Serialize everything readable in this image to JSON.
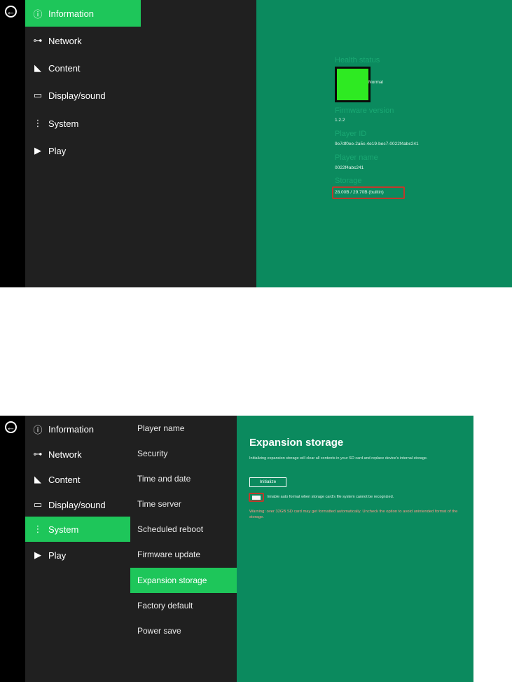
{
  "screen1": {
    "menu": [
      {
        "icon": "info-icon",
        "glyph": "ⓘ",
        "label": "Information",
        "active": true
      },
      {
        "icon": "network-icon",
        "glyph": "⊶",
        "label": "Network",
        "active": false
      },
      {
        "icon": "content-icon",
        "glyph": "◣",
        "label": "Content",
        "active": false
      },
      {
        "icon": "display-icon",
        "glyph": "▭",
        "label": "Display/sound",
        "active": false
      },
      {
        "icon": "system-icon",
        "glyph": "⋮",
        "label": "System",
        "active": false
      },
      {
        "icon": "play-icon",
        "glyph": "▶",
        "label": "Play",
        "active": false
      }
    ],
    "info": {
      "health_heading": "Health status",
      "health_value": "Normal",
      "firmware_heading": "Firmware version",
      "firmware_value": "1.2.2",
      "player_id_heading": "Player ID",
      "player_id_value": "9e7df0ee-2a5c-4e19-bec7-0022f4abc241",
      "player_name_heading": "Player name",
      "player_name_value": "0022f4abc241",
      "storage_heading": "Storage",
      "storage_value": "28.00B / 29.70B (builtin)"
    }
  },
  "screen2": {
    "menu": [
      {
        "icon": "info-icon",
        "glyph": "ⓘ",
        "label": "Information",
        "active": false
      },
      {
        "icon": "network-icon",
        "glyph": "⊶",
        "label": "Network",
        "active": false
      },
      {
        "icon": "content-icon",
        "glyph": "◣",
        "label": "Content",
        "active": false
      },
      {
        "icon": "display-icon",
        "glyph": "▭",
        "label": "Display/sound",
        "active": false
      },
      {
        "icon": "system-icon",
        "glyph": "⋮",
        "label": "System",
        "active": true
      },
      {
        "icon": "play-icon",
        "glyph": "▶",
        "label": "Play",
        "active": false
      }
    ],
    "submenu": [
      {
        "label": "Player name",
        "active": false
      },
      {
        "label": "Security",
        "active": false
      },
      {
        "label": "Time and date",
        "active": false
      },
      {
        "label": "Time server",
        "active": false
      },
      {
        "label": "Scheduled reboot",
        "active": false
      },
      {
        "label": "Firmware update",
        "active": false
      },
      {
        "label": "Expansion storage",
        "active": true
      },
      {
        "label": "Factory default",
        "active": false
      },
      {
        "label": "Power save",
        "active": false
      }
    ],
    "expansion": {
      "title": "Expansion storage",
      "description": "Initializing expansion storage will clear all contents in your SD card and replace device's internal storage.",
      "initialize_label": "Initialize",
      "toggle_label": "Enable auto format when storage card's file system cannot be recognized.",
      "toggle_on": true,
      "warning": "Warning: over 32GB SD card may get formatted automatically. Uncheck the option to avoid unintended format of the storage."
    }
  },
  "colors": {
    "accent": "#1ec65a",
    "panel": "#0b8a5e",
    "sidebar": "#202020",
    "warning": "#ff9a8a",
    "health": "#2eea22"
  }
}
